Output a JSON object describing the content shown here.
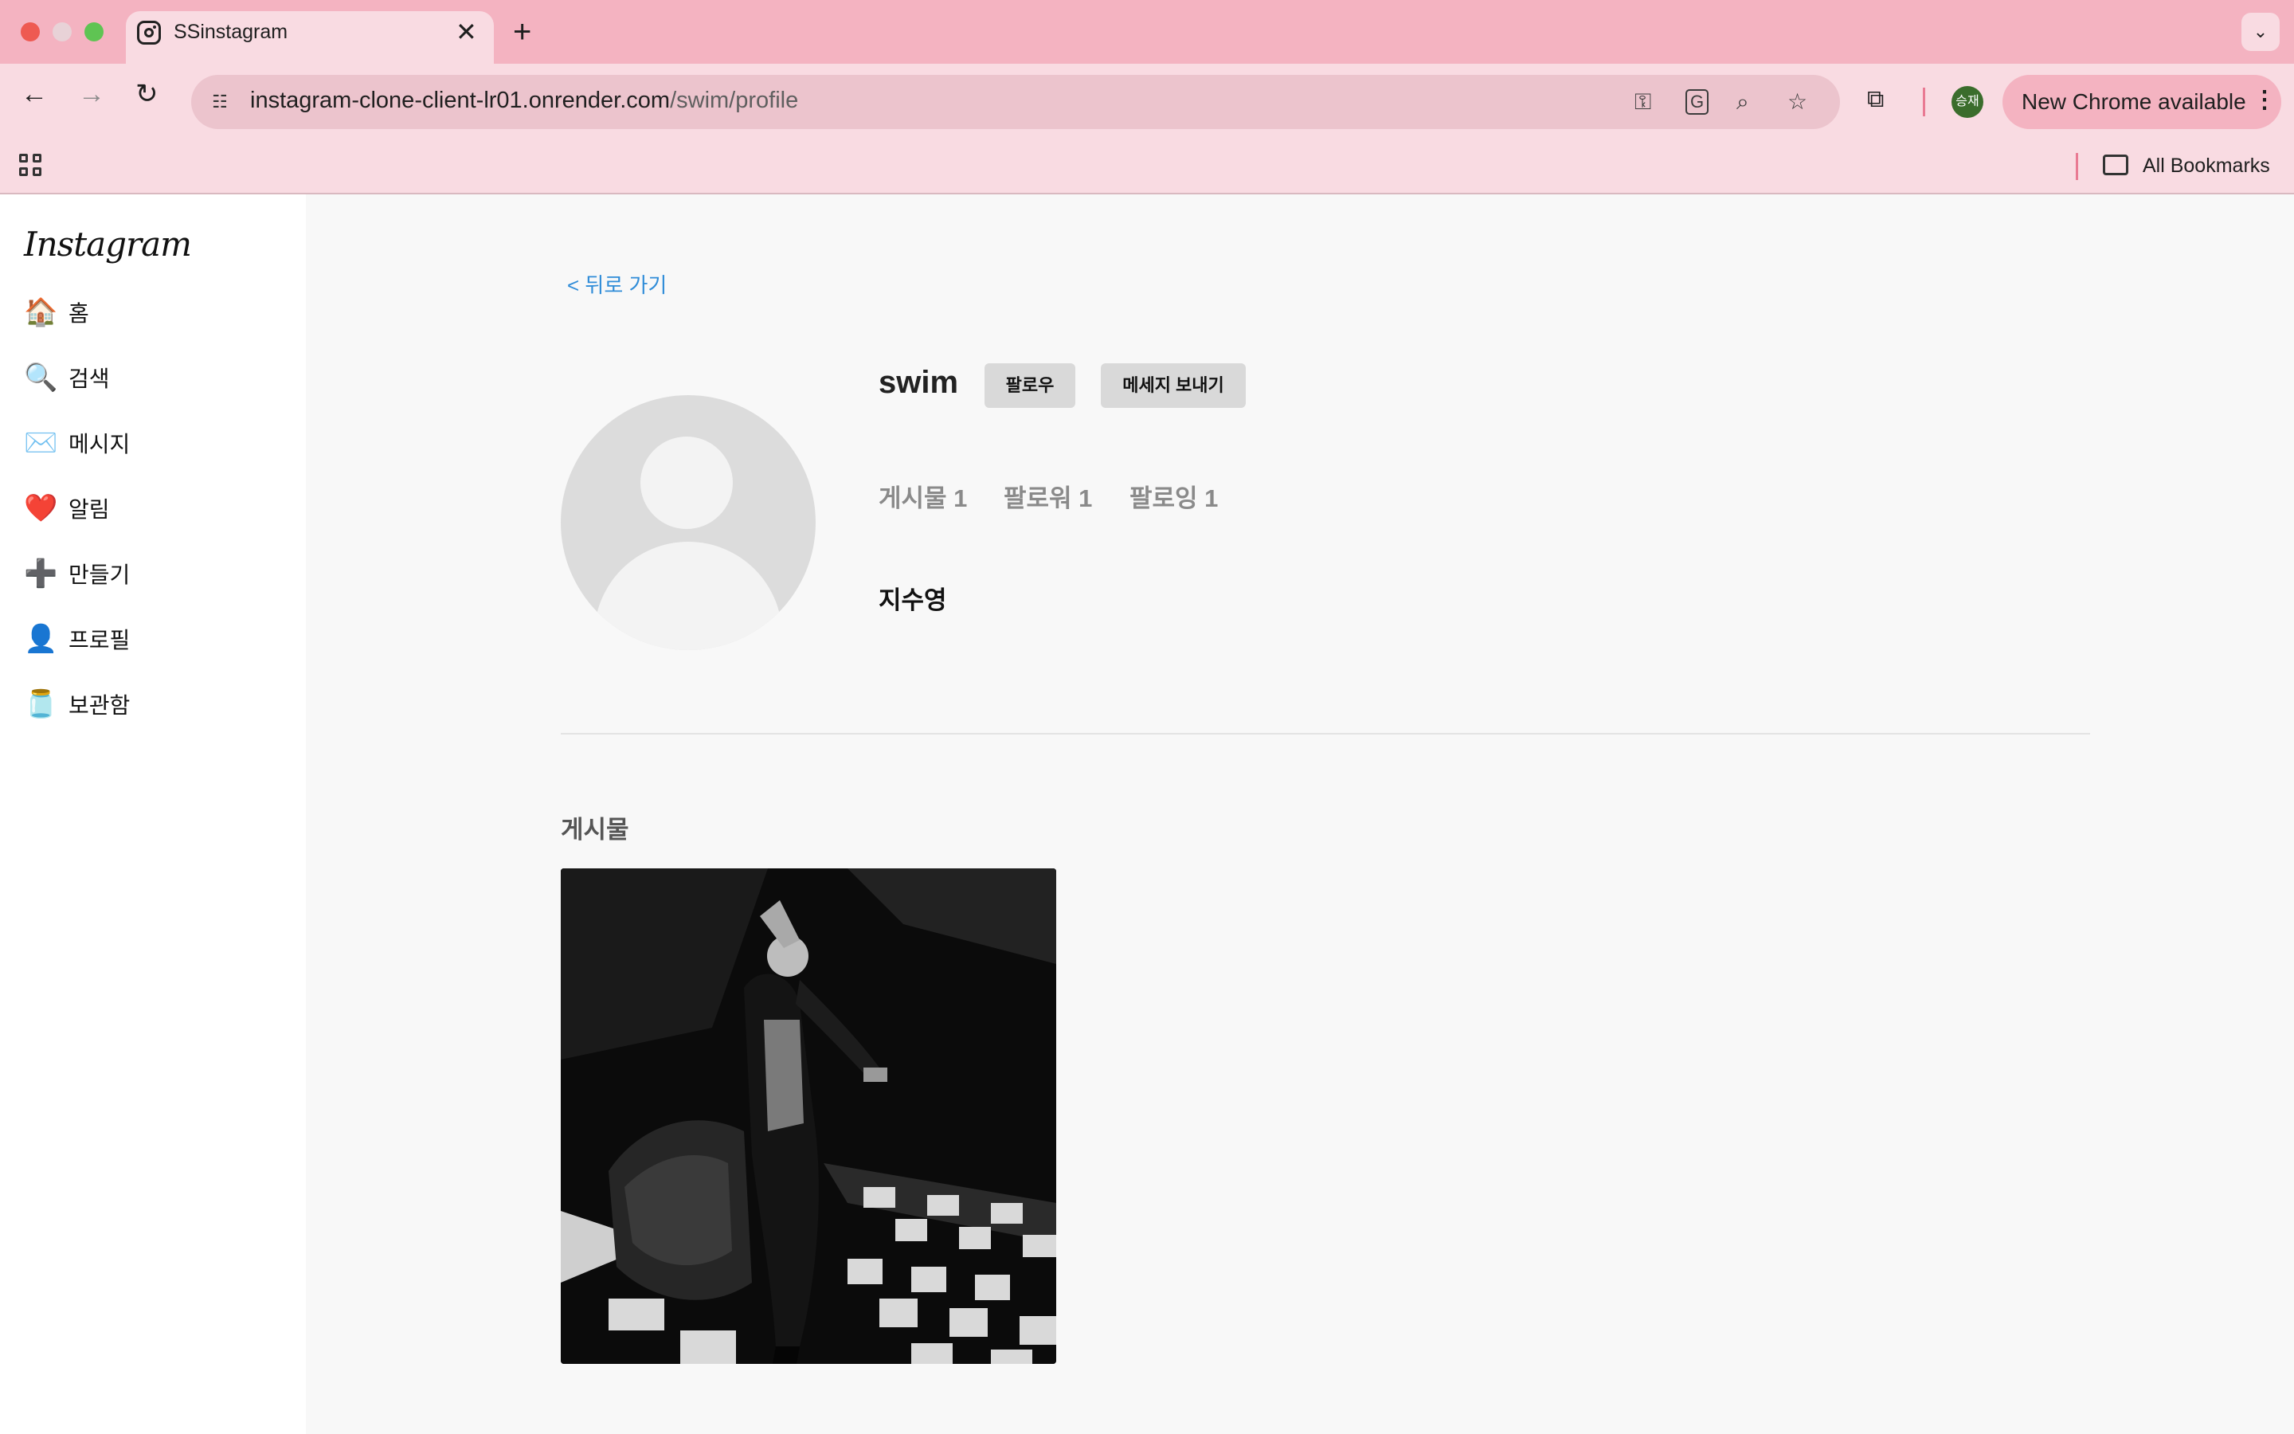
{
  "browser": {
    "tab_title": "SSinstagram",
    "tab_close": "✕",
    "new_tab": "+",
    "tab_list": "⌄",
    "url_host": "instagram-clone-client-lr01.onrender.com",
    "url_path": "/swim/profile",
    "update_label": "New Chrome available",
    "update_menu": "⋮",
    "profile_initials": "승재",
    "bookmarks_label": "All Bookmarks",
    "nav_back": "←",
    "nav_forward": "→",
    "nav_reload": "↻",
    "translate_glyph": "G"
  },
  "sidebar": {
    "logo": "Instagram",
    "items": [
      {
        "icon": "🏠",
        "label": "홈"
      },
      {
        "icon": "🔍",
        "label": "검색"
      },
      {
        "icon": "✉️",
        "label": "메시지"
      },
      {
        "icon": "❤️",
        "label": "알림"
      },
      {
        "icon": "➕",
        "label": "만들기"
      },
      {
        "icon": "👤",
        "label": "프로필"
      },
      {
        "icon": "🫙",
        "label": "보관함"
      }
    ]
  },
  "profile": {
    "back_label": "< 뒤로 가기",
    "username": "swim",
    "follow_label": "팔로우",
    "message_label": "메세지 보내기",
    "stats": {
      "posts": "게시물 1",
      "followers": "팔로워 1",
      "following": "팔로잉 1"
    },
    "full_name": "지수영"
  },
  "posts": {
    "section_title": "게시물"
  }
}
